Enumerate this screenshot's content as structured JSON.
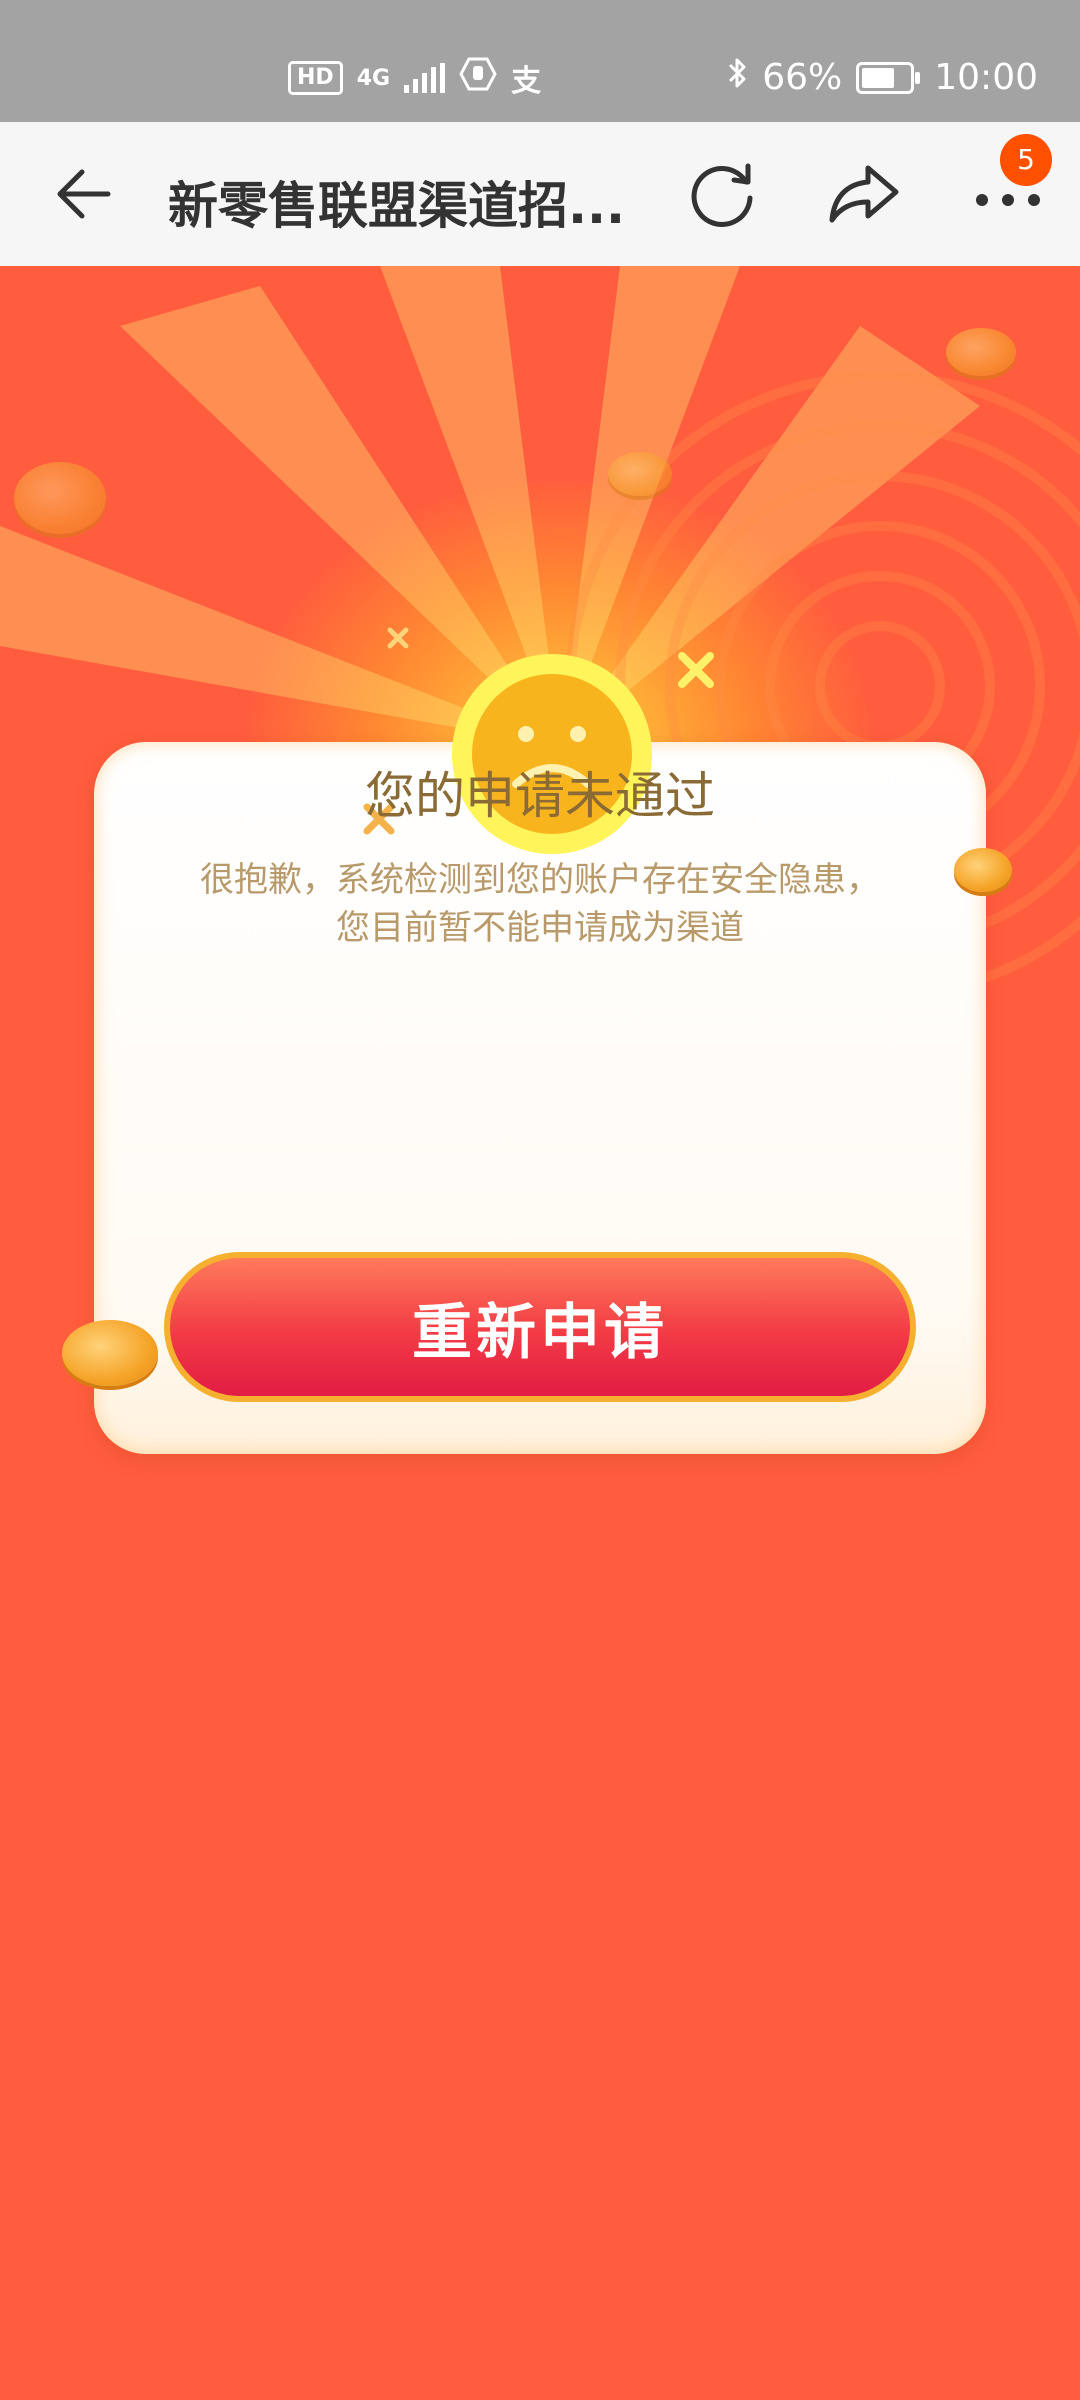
{
  "status_bar": {
    "left_badge": "HD",
    "network": "4G",
    "battery": "66%",
    "time": "10:00",
    "icons": [
      "hd-icon",
      "signal-icon",
      "hand-shield-icon",
      "alipay-icon",
      "bluetooth-icon",
      "battery-icon"
    ]
  },
  "nav": {
    "title": "新零售联盟渠道招...",
    "badge_count": "5",
    "icons": [
      "back-arrow-icon",
      "refresh-icon",
      "share-icon",
      "more-icon"
    ]
  },
  "result": {
    "headline": "您的申请未通过",
    "description_line1": "很抱歉，系统检测到您的账户存在安全隐患，",
    "description_line2": "您目前暂不能申请成为渠道",
    "button_label": "重新申请"
  },
  "colors": {
    "background": "#ff5d3e",
    "status_bar": "#a3a3a3",
    "nav_bar": "#f6f6f6",
    "badge": "#ff5000",
    "button_border": "#f5b030",
    "headline": "#8a6a35",
    "description": "#b8996a"
  }
}
